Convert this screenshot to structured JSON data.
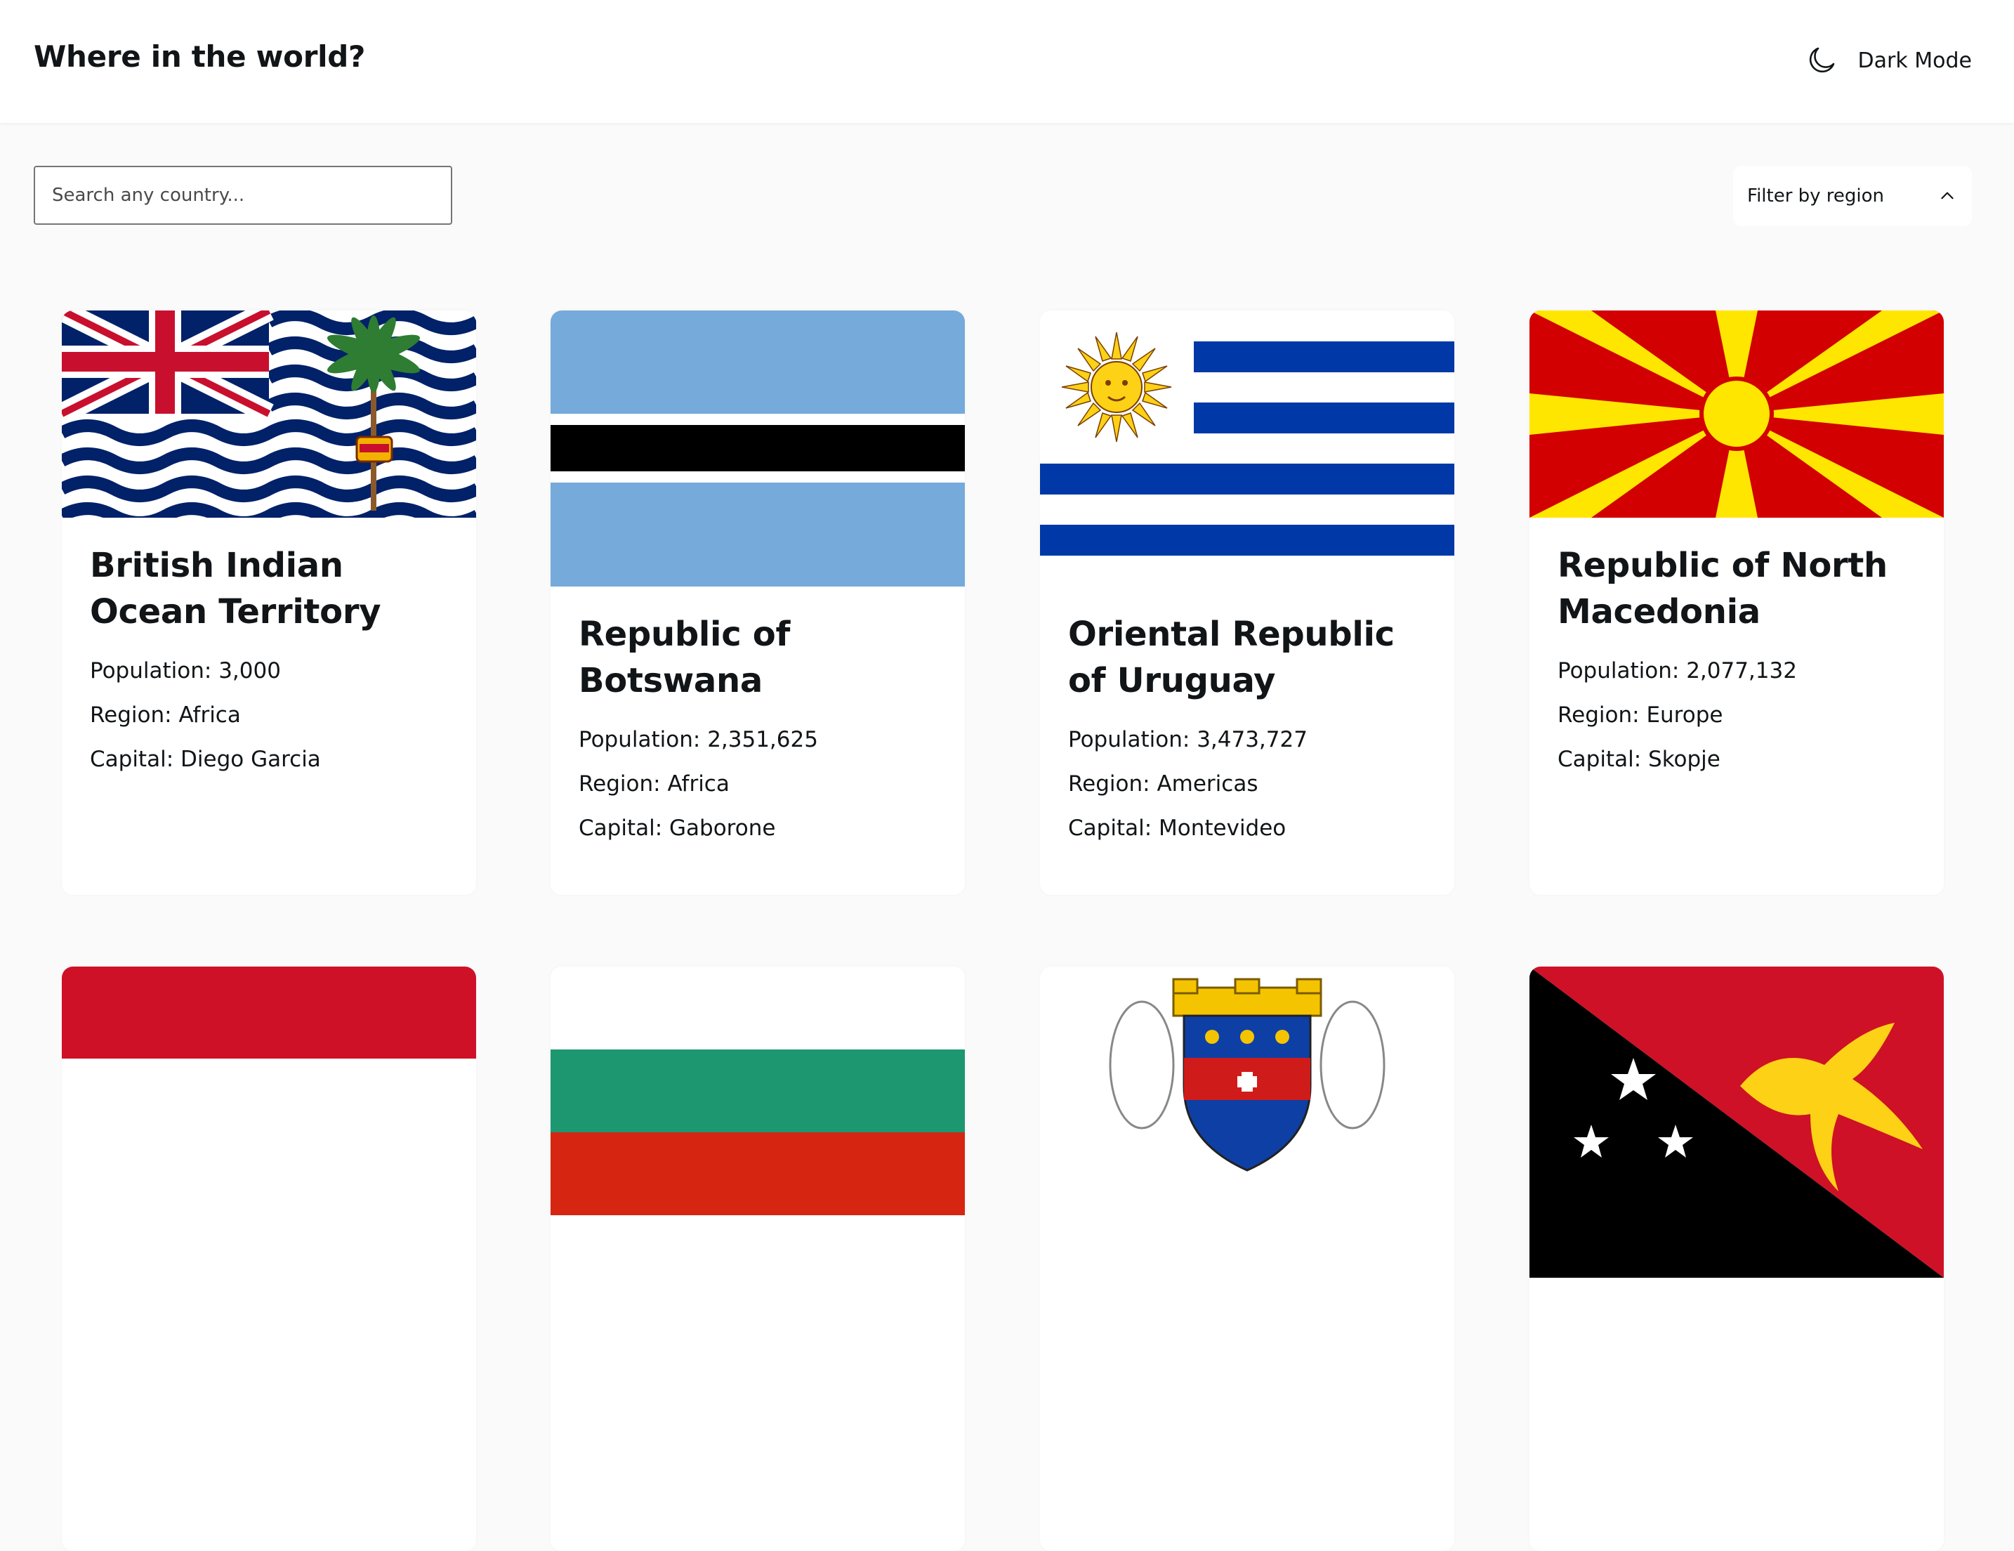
{
  "header": {
    "title": "Where in the world?",
    "dark_mode_label": "Dark Mode",
    "dark_mode_icon": "moon-icon"
  },
  "search": {
    "placeholder": "Search any country..."
  },
  "filter": {
    "label": "Filter by region",
    "icon": "chevron-up-icon"
  },
  "labels": {
    "population": "Population:",
    "region": "Region:",
    "capital": "Capital:"
  },
  "countries": [
    {
      "name": "British Indian Ocean Territory",
      "population": "3,000",
      "region": "Africa",
      "capital": "Diego Garcia",
      "flag": "british-indian-ocean-territory-flag"
    },
    {
      "name": "Republic of Botswana",
      "population": "2,351,625",
      "region": "Africa",
      "capital": "Gaborone",
      "flag": "botswana-flag"
    },
    {
      "name": "Oriental Republic of Uruguay",
      "population": "3,473,727",
      "region": "Americas",
      "capital": "Montevideo",
      "flag": "uruguay-flag"
    },
    {
      "name": "Republic of North Macedonia",
      "population": "2,077,132",
      "region": "Europe",
      "capital": "Skopje",
      "flag": "north-macedonia-flag"
    },
    {
      "flag": "indonesia-flag"
    },
    {
      "flag": "bulgaria-flag"
    },
    {
      "flag": "saint-barthelemy-flag"
    },
    {
      "flag": "papua-new-guinea-flag"
    }
  ],
  "colors": {
    "page_bg": "#fafafa",
    "card_bg": "#ffffff",
    "text": "#111517"
  }
}
